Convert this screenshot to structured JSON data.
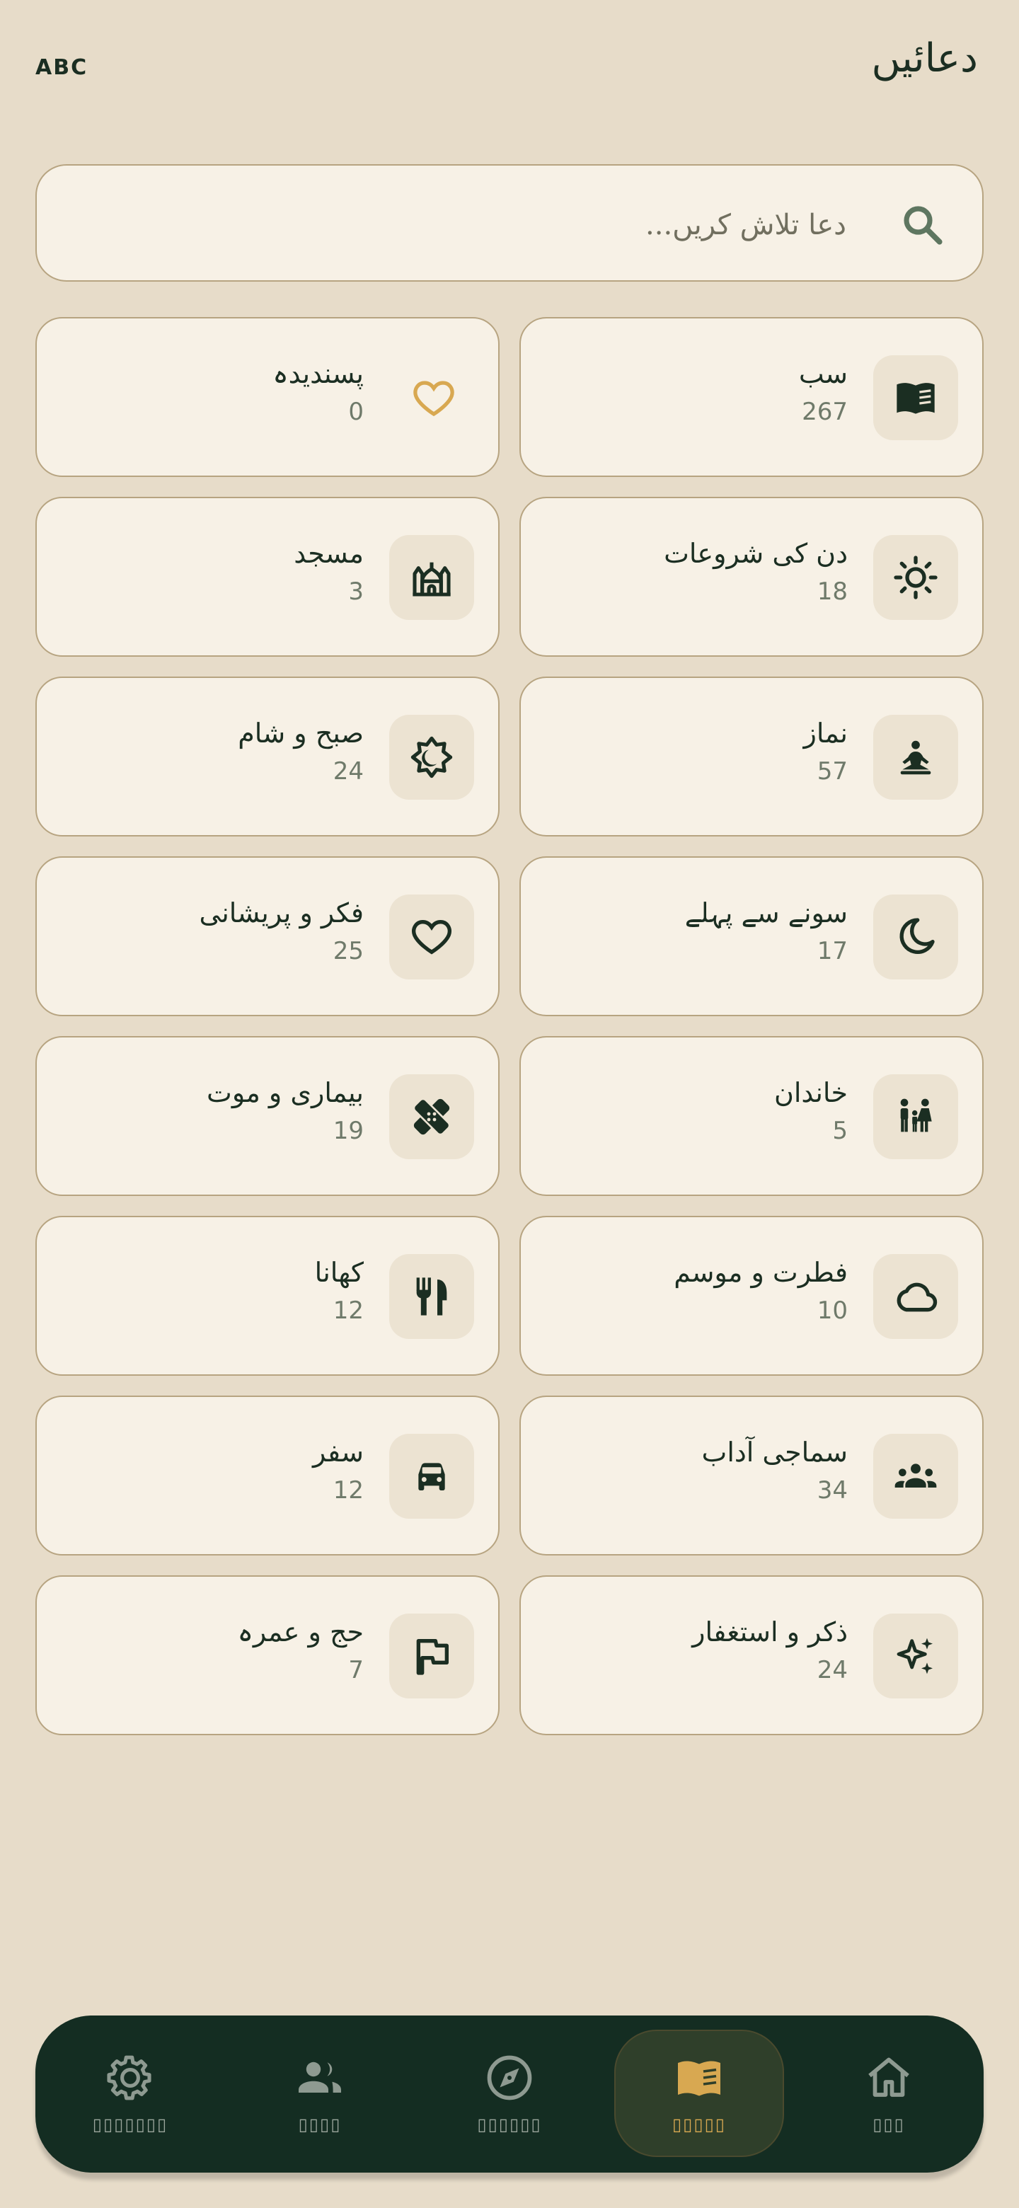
{
  "header": {
    "lang_toggle": "ABC",
    "title": "دعائیں"
  },
  "search": {
    "placeholder": "دعا تلاش کریں..."
  },
  "categories": [
    {
      "name": "سب",
      "count": "267",
      "icon": "book-icon"
    },
    {
      "name": "پسندیدہ",
      "count": "0",
      "icon": "heart-outline-icon"
    },
    {
      "name": "دن کی شروعات",
      "count": "18",
      "icon": "sun-icon"
    },
    {
      "name": "مسجد",
      "count": "3",
      "icon": "mosque-icon"
    },
    {
      "name": "نماز",
      "count": "57",
      "icon": "meditation-icon"
    },
    {
      "name": "صبح و شام",
      "count": "24",
      "icon": "day-night-icon"
    },
    {
      "name": "سونے سے پہلے",
      "count": "17",
      "icon": "moon-icon"
    },
    {
      "name": "فکر و پریشانی",
      "count": "25",
      "icon": "heart-icon"
    },
    {
      "name": "خاندان",
      "count": "5",
      "icon": "family-icon"
    },
    {
      "name": "بیماری و موت",
      "count": "19",
      "icon": "bandage-icon"
    },
    {
      "name": "فطرت و موسم",
      "count": "10",
      "icon": "cloud-icon"
    },
    {
      "name": "کھانا",
      "count": "12",
      "icon": "fork-knife-icon"
    },
    {
      "name": "سماجی آداب",
      "count": "34",
      "icon": "group-icon"
    },
    {
      "name": "سفر",
      "count": "12",
      "icon": "car-icon"
    },
    {
      "name": "ذکر و استغفار",
      "count": "24",
      "icon": "sparkle-icon"
    },
    {
      "name": "حج و عمرہ",
      "count": "7",
      "icon": "flag-icon"
    }
  ],
  "nav": {
    "items": [
      {
        "label": "▯▯▯▯▯▯▯",
        "icon": "gear-icon",
        "active": false
      },
      {
        "label": "▯▯▯▯",
        "icon": "people-icon",
        "active": false
      },
      {
        "label": "▯▯▯▯▯▯",
        "icon": "compass-icon",
        "active": false
      },
      {
        "label": "▯▯▯▯▯",
        "icon": "book-icon",
        "active": true
      },
      {
        "label": "▯▯▯",
        "icon": "home-icon",
        "active": false
      }
    ]
  },
  "colors": {
    "background": "#e7dcc9",
    "card": "#f7f1e6",
    "accent": "#d8a851",
    "dark": "#142d22"
  }
}
